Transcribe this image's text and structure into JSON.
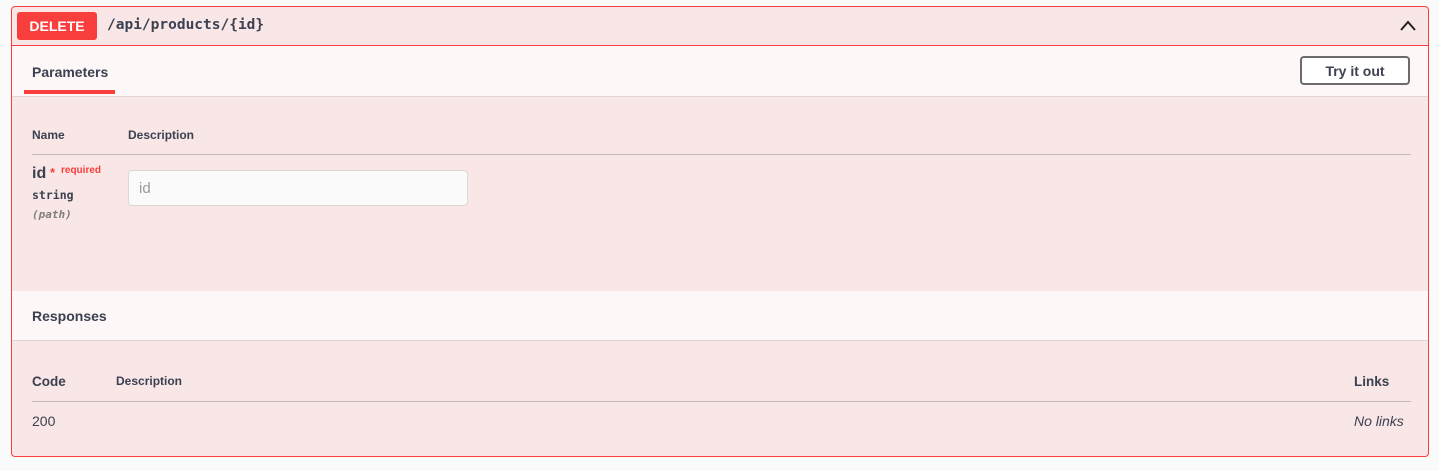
{
  "operation": {
    "method": "DELETE",
    "path": "/api/products/{id}"
  },
  "parameters_section": {
    "tab_label": "Parameters",
    "try_button": "Try it out",
    "columns": {
      "name": "Name",
      "description": "Description"
    },
    "params": [
      {
        "name": "id",
        "required_star": "*",
        "required_label": "required",
        "type": "string",
        "location": "(path)",
        "placeholder": "id"
      }
    ]
  },
  "responses_section": {
    "title": "Responses",
    "columns": {
      "code": "Code",
      "description": "Description",
      "links": "Links"
    },
    "rows": [
      {
        "code": "200",
        "description": "",
        "links": "No links"
      }
    ]
  },
  "colors": {
    "accent": "#f93e3e",
    "background": "#f9e6e6"
  },
  "icons": {
    "collapse": "chevron-up-icon"
  }
}
